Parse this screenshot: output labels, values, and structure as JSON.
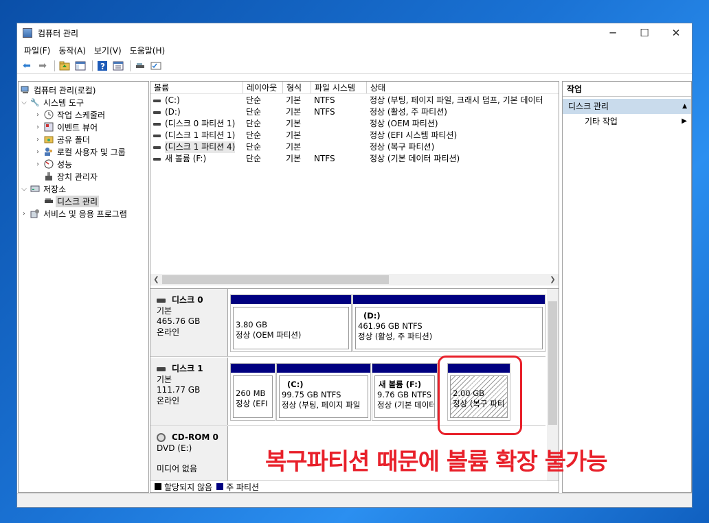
{
  "window": {
    "title": "컴퓨터 관리",
    "minimize": "─",
    "maximize": "☐",
    "close": "✕"
  },
  "menu": [
    "파일(F)",
    "동작(A)",
    "보기(V)",
    "도움말(H)"
  ],
  "tree": {
    "root": "컴퓨터 관리(로컬)",
    "system_tools": "시스템 도구",
    "task_scheduler": "작업 스케줄러",
    "event_viewer": "이벤트 뷰어",
    "shared_folders": "공유 폴더",
    "local_users": "로컬 사용자 및 그룹",
    "performance": "성능",
    "device_manager": "장치 관리자",
    "storage": "저장소",
    "disk_management": "디스크 관리",
    "services_apps": "서비스 및 응용 프로그램"
  },
  "volumes": {
    "headers": [
      "볼륨",
      "레이아웃",
      "형식",
      "파일 시스템",
      "상태"
    ],
    "rows": [
      [
        "(C:)",
        "단순",
        "기본",
        "NTFS",
        "정상 (부팅, 페이지 파일, 크래시 덤프, 기본 데이터"
      ],
      [
        "(D:)",
        "단순",
        "기본",
        "NTFS",
        "정상 (활성, 주 파티션)"
      ],
      [
        "(디스크 0 파티션 1)",
        "단순",
        "기본",
        "",
        "정상 (OEM 파티션)"
      ],
      [
        "(디스크 1 파티션 1)",
        "단순",
        "기본",
        "",
        "정상 (EFI 시스템 파티션)"
      ],
      [
        "(디스크 1 파티션 4)",
        "단순",
        "기본",
        "",
        "정상 (복구 파티션)"
      ],
      [
        "새 볼륨 (F:)",
        "단순",
        "기본",
        "NTFS",
        "정상 (기본 데이터 파티션)"
      ]
    ]
  },
  "disks": {
    "disk0": {
      "name": "디스크 0",
      "type": "기본",
      "size": "465.76 GB",
      "status": "온라인",
      "p1": {
        "size": "3.80 GB",
        "status": "정상 (OEM 파티션)"
      },
      "p2": {
        "name": "(D:)",
        "size": "461.96 GB NTFS",
        "status": "정상 (활성, 주 파티션)"
      }
    },
    "disk1": {
      "name": "디스크 1",
      "type": "기본",
      "size": "111.77 GB",
      "status": "온라인",
      "p1": {
        "size": "260 MB",
        "status": "정상 (EFI"
      },
      "p2": {
        "name": "(C:)",
        "size": "99.75 GB NTFS",
        "status": "정상 (부팅, 페이지 파일"
      },
      "p3": {
        "name": "새 볼륨  (F:)",
        "size": "9.76 GB NTFS",
        "status": "정상 (기본 데이터"
      },
      "p4": {
        "size": "2.00 GB",
        "status": "정상 (복구 파티"
      }
    },
    "cdrom": {
      "name": "CD-ROM 0",
      "type": "DVD (E:)",
      "media": "미디어 없음"
    }
  },
  "legend": {
    "unallocated": "할당되지 않음",
    "primary": "주 파티션"
  },
  "actions": {
    "title": "작업",
    "group": "디스크 관리",
    "more": "기타 작업"
  },
  "annotation": "복구파티션 때문에 볼륨 확장 불가능",
  "colors": {
    "partition_bar": "#000080",
    "annotation": "#e8202a",
    "selected_group": "#c9dbec"
  }
}
